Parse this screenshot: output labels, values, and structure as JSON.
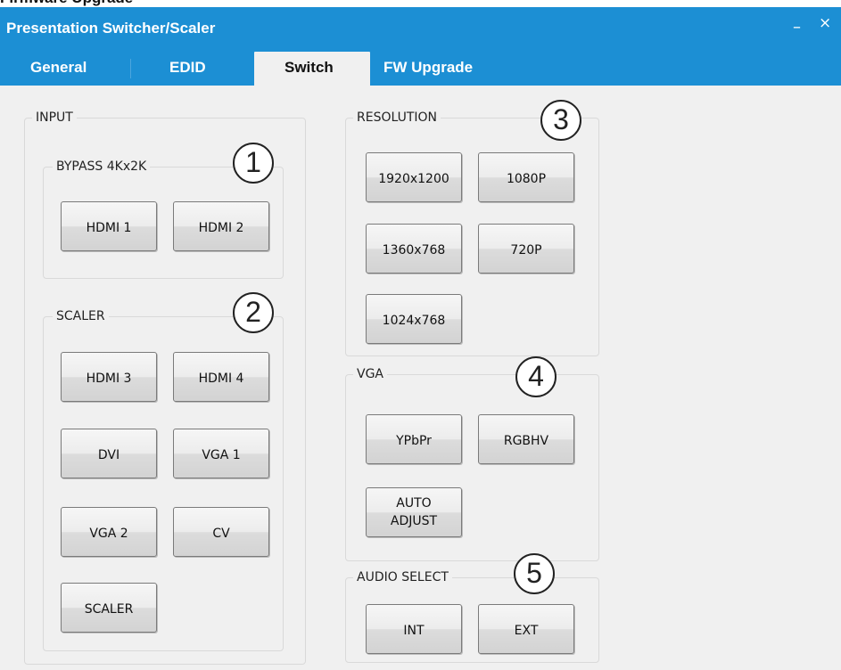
{
  "window": {
    "cropped_heading": "Firmware Upgrade",
    "title": "Presentation Switcher/Scaler",
    "min_glyph": "–",
    "close_glyph": "×"
  },
  "tabs": [
    {
      "label": "General",
      "active": false
    },
    {
      "label": "EDID",
      "active": false
    },
    {
      "label": "Switch",
      "active": true
    },
    {
      "label": "FW Upgrade",
      "active": false
    }
  ],
  "input": {
    "label": "INPUT",
    "bypass": {
      "label": "BYPASS 4Kx2K",
      "marker": "1",
      "buttons": [
        "HDMI 1",
        "HDMI 2"
      ]
    },
    "scaler": {
      "label": "SCALER",
      "marker": "2",
      "buttons": [
        "HDMI 3",
        "HDMI 4",
        "DVI",
        "VGA 1",
        "VGA 2",
        "CV",
        "SCALER"
      ]
    }
  },
  "resolution": {
    "label": "RESOLUTION",
    "marker": "3",
    "buttons": [
      "1920x1200",
      "1080P",
      "1360x768",
      "720P",
      "1024x768"
    ]
  },
  "vga": {
    "label": "VGA",
    "marker": "4",
    "buttons": [
      "YPbPr",
      "RGBHV"
    ],
    "auto_adjust": {
      "line1": "AUTO",
      "line2": "ADJUST"
    }
  },
  "audio": {
    "label": "AUDIO SELECT",
    "marker": "5",
    "buttons": [
      "INT",
      "EXT"
    ]
  }
}
